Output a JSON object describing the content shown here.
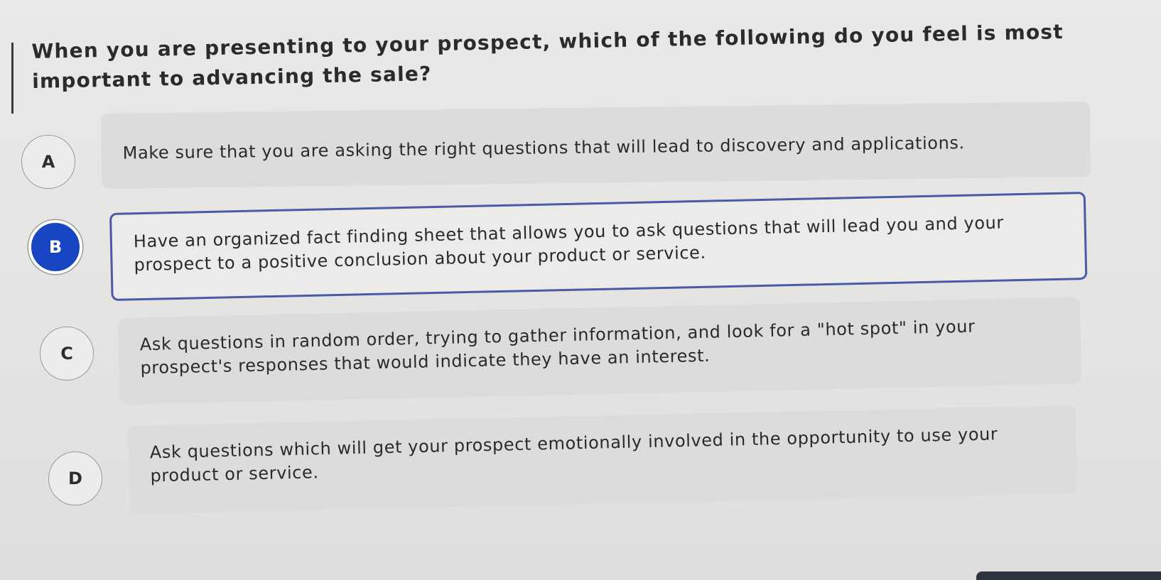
{
  "question": {
    "text": "When you are presenting to your prospect, which of the following do you feel is most important to advancing the sale?"
  },
  "options": [
    {
      "letter": "A",
      "text": "Make sure that you are asking the right questions that will lead to discovery and applications.",
      "selected": false
    },
    {
      "letter": "B",
      "text": "Have an organized fact finding sheet that allows you to ask questions that will lead you and your prospect to a positive conclusion about your product or service.",
      "selected": true
    },
    {
      "letter": "C",
      "text": "Ask questions in random order, trying to gather information, and look for a \"hot spot\" in your prospect's responses that would indicate they have an interest.",
      "selected": false
    },
    {
      "letter": "D",
      "text": "Ask questions which will get your prospect emotionally involved in the opportunity to use your product or service.",
      "selected": false
    }
  ],
  "colors": {
    "selected_circle": "#1845c4",
    "selected_border": "#4a5aa8",
    "card_background": "#dcdcda",
    "text": "#2a2a2c"
  }
}
